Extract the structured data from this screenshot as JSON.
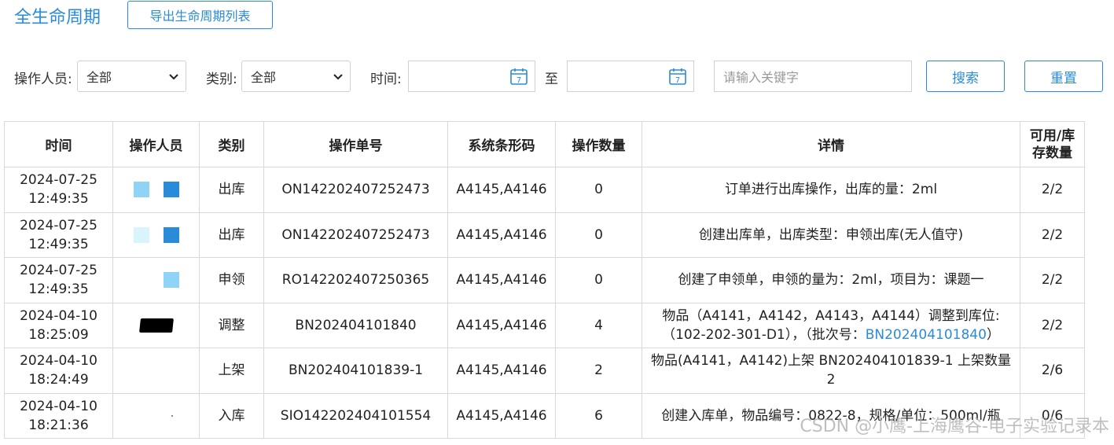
{
  "header": {
    "title": "全生命周期",
    "export_label": "导出生命周期列表"
  },
  "filters": {
    "operator_label": "操作人员:",
    "operator_value": "全部",
    "category_label": "类别:",
    "category_value": "全部",
    "time_label": "时间:",
    "to_label": "至",
    "keyword_placeholder": "请输入关键字",
    "search_label": "搜索",
    "reset_label": "重置",
    "calendar_glyph": "7"
  },
  "table": {
    "headers": [
      "时间",
      "操作人员",
      "类别",
      "操作单号",
      "系统条形码",
      "操作数量",
      "详情",
      "可用/库存数量"
    ],
    "rows": [
      {
        "date": "2024-07-25",
        "time": "12:49:35",
        "category": "出库",
        "order": "ON142202407252473",
        "barcode": "A4145,A4146",
        "qty": "0",
        "detail": "订单进行出库操作，出库的量：2ml",
        "stock": "2/2"
      },
      {
        "date": "2024-07-25",
        "time": "12:49:35",
        "category": "出库",
        "order": "ON142202407252473",
        "barcode": "A4145,A4146",
        "qty": "0",
        "detail": "创建出库单，出库类型：申领出库(无人值守)",
        "stock": "2/2"
      },
      {
        "date": "2024-07-25",
        "time": "12:49:35",
        "category": "申领",
        "order": "RO142202407250365",
        "barcode": "A4145,A4146",
        "qty": "0",
        "detail": "创建了申领单，申领的量为：2ml，项目为：课题一",
        "stock": "2/2"
      },
      {
        "date": "2024-04-10",
        "time": "18:25:09",
        "category": "调整",
        "order": "BN202404101840",
        "barcode": "A4145,A4146",
        "qty": "4",
        "detail_line1": "物品（A4141，A4142，A4143，A4144）调整到库位:",
        "detail_line2_pre": "（102-202-301-D1），（批次号：",
        "detail_link": "BN202404101840",
        "detail_line2_post": "）",
        "stock": "2/2"
      },
      {
        "date": "2024-04-10",
        "time": "18:24:49",
        "category": "上架",
        "order": "BN202404101839-1",
        "barcode": "A4145,A4146",
        "qty": "2",
        "detail": "物品(A4141，A4142)上架 BN202404101839-1 上架数量 2",
        "stock": "2/6"
      },
      {
        "date": "2024-04-10",
        "time": "18:21:36",
        "category": "入库",
        "order": "SIO142202404101554",
        "barcode": "A4145,A4146",
        "qty": "6",
        "detail": "创建入库单，物品编号：0822-8，规格/单位：500ml/瓶",
        "stock": "0/6"
      }
    ]
  },
  "colors": {
    "accent": "#2a8bd8",
    "swatch_light": "#8fd3f7",
    "swatch_pale": "#d9f5fb",
    "swatch_blue": "#2a8bd8"
  },
  "watermark": "CSDN @小鹰-上海鹰谷-电子实验记录本"
}
